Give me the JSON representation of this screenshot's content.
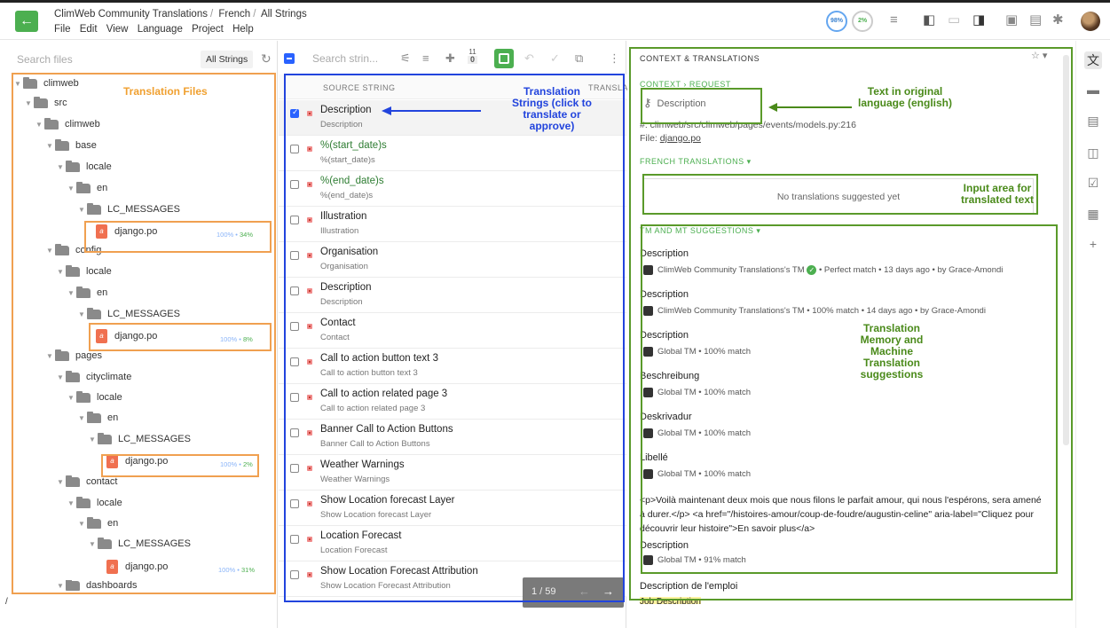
{
  "header": {
    "breadcrumb": [
      "ClimWeb Community Translations",
      "French",
      "All Strings"
    ],
    "menus": [
      "File",
      "Edit",
      "View",
      "Language",
      "Project",
      "Help"
    ],
    "progress_blue": "98%",
    "progress_green": "2%"
  },
  "left": {
    "search_placeholder": "Search files",
    "filter_label": "All Strings",
    "tree": [
      {
        "label": "climweb"
      },
      {
        "label": "src"
      },
      {
        "label": "climweb"
      },
      {
        "label": "base"
      },
      {
        "label": "locale"
      },
      {
        "label": "en"
      },
      {
        "label": "LC_MESSAGES"
      },
      {
        "label": "django.po",
        "pct": "100%",
        "pct2": "34%"
      },
      {
        "label": "config"
      },
      {
        "label": "locale"
      },
      {
        "label": "en"
      },
      {
        "label": "LC_MESSAGES"
      },
      {
        "label": "django.po",
        "pct": "100%",
        "pct2": "8%"
      },
      {
        "label": "pages"
      },
      {
        "label": "cityclimate"
      },
      {
        "label": "locale"
      },
      {
        "label": "en"
      },
      {
        "label": "LC_MESSAGES"
      },
      {
        "label": "django.po",
        "pct": "100%",
        "pct2": "2%"
      },
      {
        "label": "contact"
      },
      {
        "label": "locale"
      },
      {
        "label": "en"
      },
      {
        "label": "LC_MESSAGES"
      },
      {
        "label": "django.po",
        "pct": "100%",
        "pct2": "31%"
      },
      {
        "label": "dashboards"
      }
    ],
    "bottom_mark": "/"
  },
  "middle": {
    "search_placeholder": "Search strin...",
    "counter_top": "11",
    "counter_bottom": "0",
    "col_source": "SOURCE STRING",
    "col_translation": "TRANSLATION",
    "strings": [
      {
        "main": "Description",
        "sub": "Description"
      },
      {
        "main": "%(start_date)s",
        "sub": "%(start_date)s"
      },
      {
        "main": "%(end_date)s",
        "sub": "%(end_date)s"
      },
      {
        "main": "Illustration",
        "sub": "Illustration"
      },
      {
        "main": "Organisation",
        "sub": "Organisation"
      },
      {
        "main": "Description",
        "sub": "Description"
      },
      {
        "main": "Contact",
        "sub": "Contact"
      },
      {
        "main": "Call to action button text 3",
        "sub": "Call to action button text 3"
      },
      {
        "main": "Call to action related page 3",
        "sub": "Call to action related page 3"
      },
      {
        "main": "Banner Call to Action Buttons",
        "sub": "Banner Call to Action Buttons"
      },
      {
        "main": "Weather Warnings",
        "sub": "Weather Warnings"
      },
      {
        "main": "Show Location forecast Layer",
        "sub": "Show Location forecast Layer"
      },
      {
        "main": "Location Forecast",
        "sub": "Location Forecast"
      },
      {
        "main": "Show Location Forecast Attribution",
        "sub": "Show Location Forecast Attribution"
      }
    ],
    "pager": "1 / 59"
  },
  "right": {
    "title": "CONTEXT & TRANSLATIONS",
    "tabs": "CONTEXT  ›  REQUEST",
    "original": "Description",
    "path": "#: climweb/src/climweb/pages/events/models.py:216",
    "file_label": "File:",
    "file_name": "django.po",
    "french_head": "FRENCH TRANSLATIONS  ▾",
    "no_translations": "No translations suggested yet",
    "tm_head": "TM AND MT SUGGESTIONS  ▾",
    "suggestions": [
      {
        "text": "Description",
        "meta": "ClimWeb Community Translations's TM",
        "extra": "• Perfect match • 13 days ago • by Grace-Amondi"
      },
      {
        "text": "Description",
        "meta": "ClimWeb Community Translations's TM • 100% match • 14 days ago • by Grace-Amondi"
      },
      {
        "text": "Description",
        "meta": "Global TM • 100% match"
      },
      {
        "text": "Beschreibung",
        "meta": "Global TM • 100% match"
      },
      {
        "text": "Deskrivadur",
        "meta": "Global TM • 100% match"
      },
      {
        "text": "Libellé",
        "meta": "Global TM • 100% match"
      }
    ],
    "long_suggestion": "<p>Voilà maintenant deux mois que nous filons le parfait amour, qui nous l'espérons, sera amené à durer.</p> <a href=\"/histoires-amour/coup-de-foudre/augustin-celine\" aria-label=\"Cliquez pour découvrir leur histoire\">En savoir plus</a>",
    "long_sub": "Description",
    "long_meta": "Global TM • 91% match",
    "last_text": "Description de l'emploi",
    "last_sub_partial": "Job Description"
  },
  "annotations": {
    "translation_files": "Translation Files",
    "translation_strings": "Translation Strings (click to translate or approve)",
    "original_text": "Text in original language (english)",
    "input_area": "Input area for translated text",
    "tm_mt": "Translation Memory and Machine Translation suggestions"
  },
  "colors": {
    "accent_green": "#4caf50",
    "annotation_orange": "#f0a050",
    "annotation_blue": "#2244dd",
    "annotation_green": "#5a9a2a"
  }
}
